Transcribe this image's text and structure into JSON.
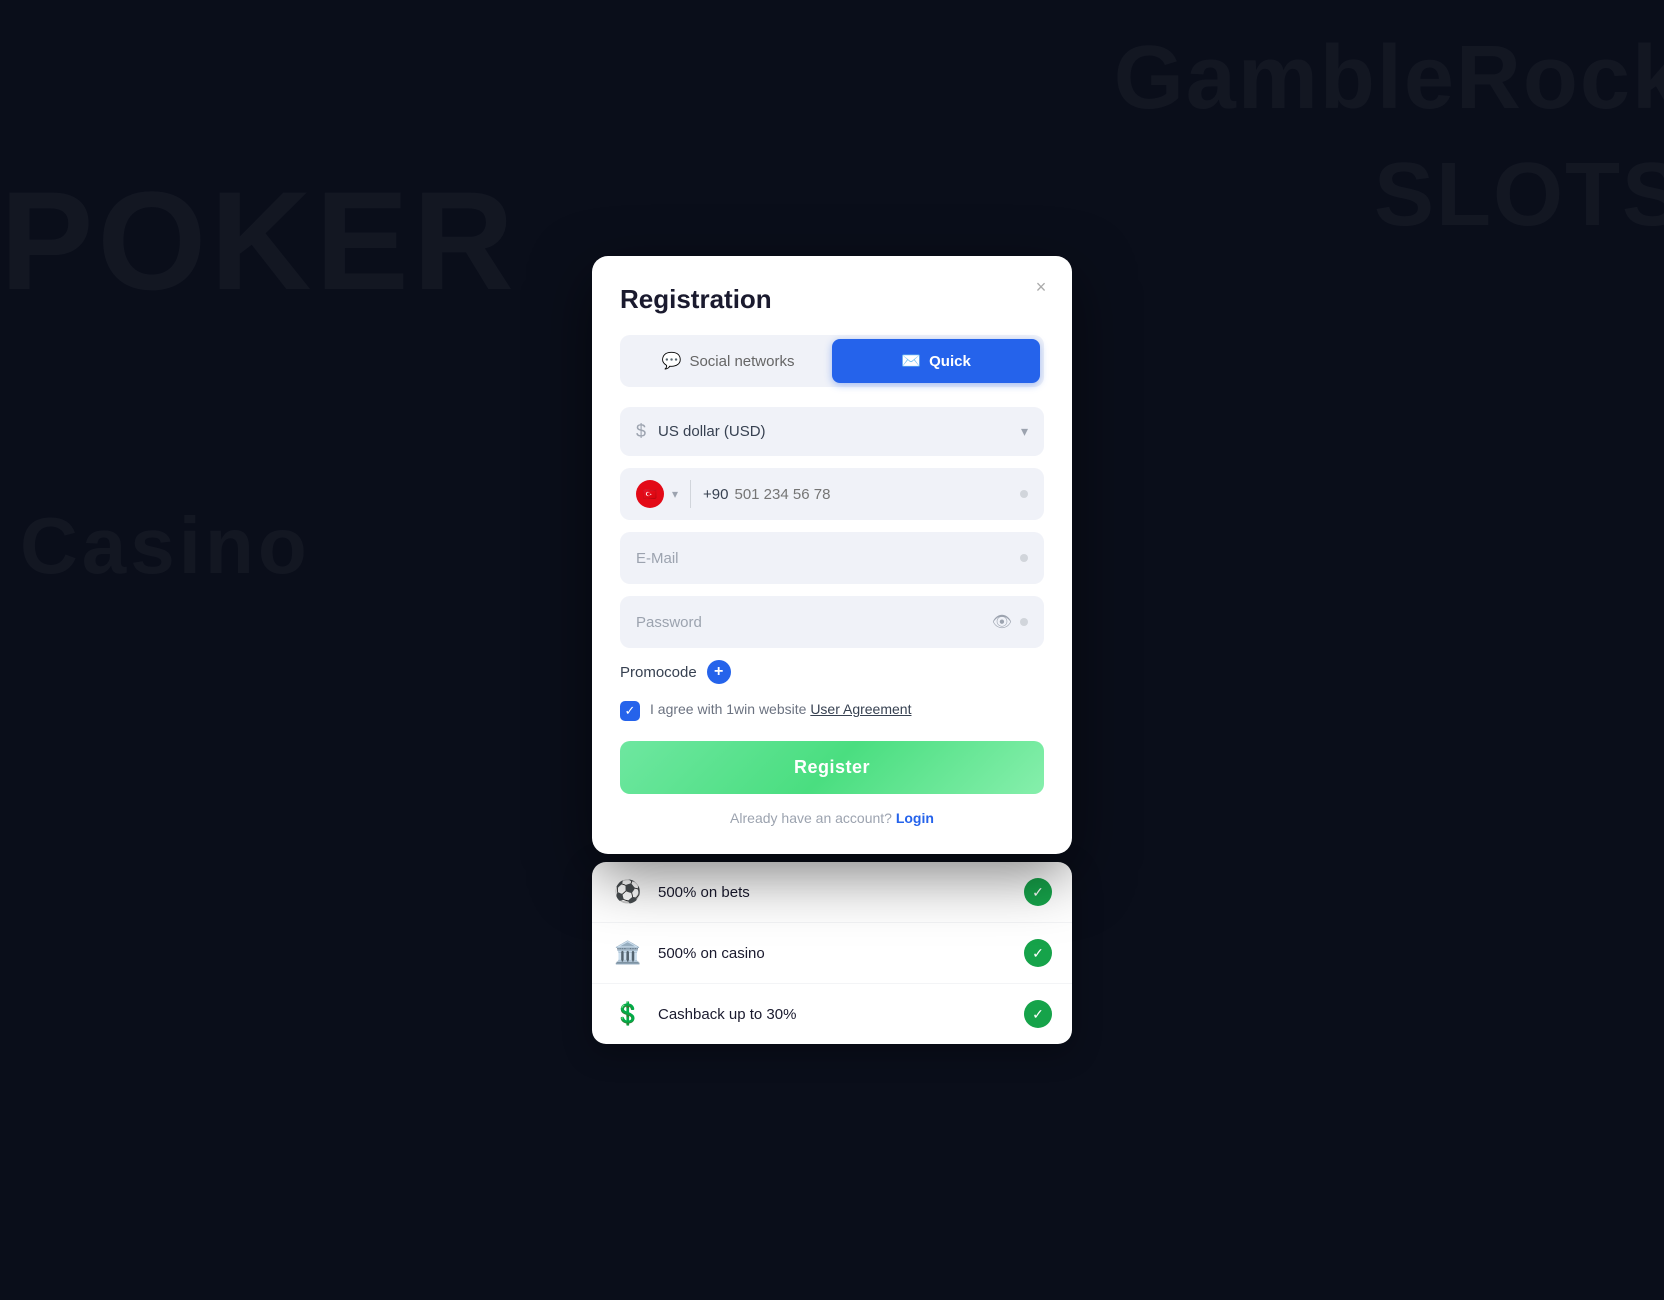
{
  "background": {
    "bgText1": "POKER",
    "bgText2": "Casino",
    "bgTextRight1": "GambleRock",
    "bgTextRight2": "SLOTS"
  },
  "modal": {
    "title": "Registration",
    "closeLabel": "×",
    "tabs": [
      {
        "id": "social",
        "label": "Social networks",
        "icon": "💬",
        "active": false
      },
      {
        "id": "quick",
        "label": "Quick",
        "icon": "✉",
        "active": true
      }
    ],
    "currencySelect": {
      "icon": "$",
      "value": "US dollar (USD)",
      "placeholder": "US dollar (USD)"
    },
    "phoneField": {
      "countryCode": "+90",
      "flag": "🇹🇷",
      "placeholder": "501 234 56 78"
    },
    "emailField": {
      "placeholder": "E-Mail"
    },
    "passwordField": {
      "placeholder": "Password"
    },
    "promocode": {
      "label": "Promocode",
      "addButtonLabel": "+"
    },
    "agreement": {
      "text": "I agree with 1win website ",
      "linkText": "User Agreement",
      "checked": true
    },
    "registerButton": "Register",
    "loginPrompt": {
      "text": "Already have an account? ",
      "linkText": "Login"
    }
  },
  "promoCard": {
    "items": [
      {
        "emoji": "⚽",
        "text": "500% on bets",
        "checked": true
      },
      {
        "emoji": "🏛️",
        "text": "500% on casino",
        "checked": true
      },
      {
        "emoji": "💲",
        "text": "Cashback up to 30%",
        "checked": true
      }
    ]
  }
}
